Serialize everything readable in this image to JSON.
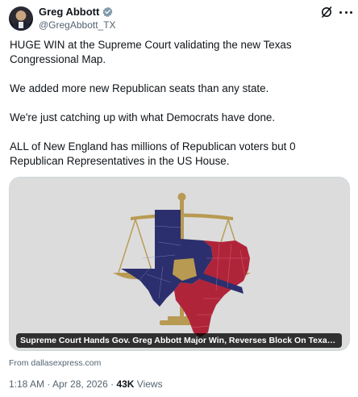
{
  "author": {
    "name": "Greg Abbott",
    "handle": "@GregAbbott_TX",
    "verified_badge": "verified-gray-badge",
    "badge_color": "#829aab"
  },
  "header_icons": [
    "grok-icon",
    "more-icon"
  ],
  "tweet": {
    "paragraphs": [
      "HUGE WIN at the Supreme Court validating the new Texas Congressional Map.",
      "We added more new Republican seats than any state.",
      "We're just catching up with what Democrats have done.",
      "ALL of New England has millions of Republican voters but 0 Republican Representatives in the US House."
    ]
  },
  "card": {
    "caption": "Supreme Court Hands Gov. Greg Abbott Major Win, Reverses Block On Texas GOP Co...",
    "source": "From dallasexpress.com",
    "colors": {
      "background": "#dcdcdc",
      "republican": "#b0243a",
      "democrat": "#2c2f6e",
      "scale_gold": "#b89a52"
    }
  },
  "meta": {
    "time": "1:18 AM",
    "separator1": " · ",
    "date": "Apr 28, 2026",
    "separator2": " · ",
    "views_count": "43K",
    "views_label": " Views"
  }
}
